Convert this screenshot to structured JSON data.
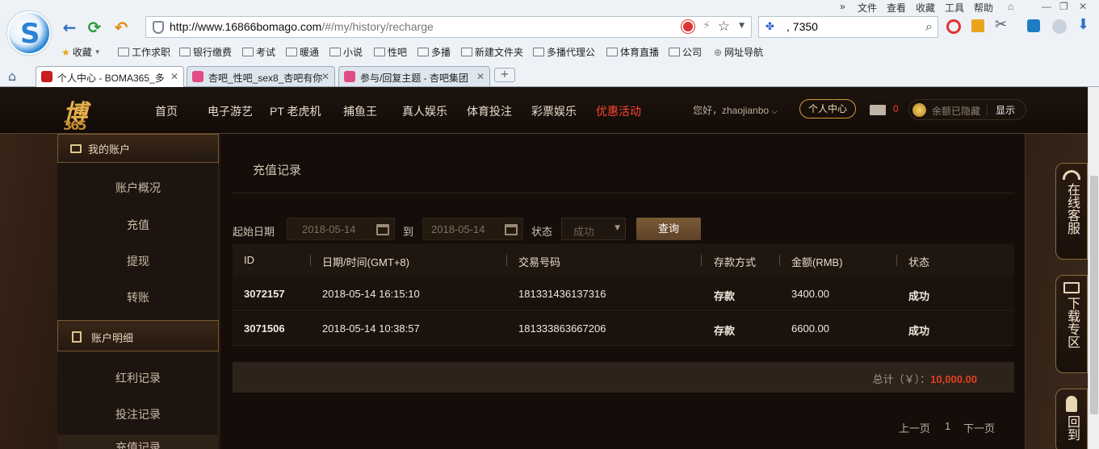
{
  "browser": {
    "url_host": "http://www.16866bomago.com",
    "url_path": "/#/my/history/recharge",
    "search_value": ", 7350",
    "menu": [
      "文件",
      "查看",
      "收藏",
      "工具",
      "帮助"
    ],
    "bookmarks": [
      "收藏",
      "工作求职",
      "银行缴费",
      "考试",
      "暖通",
      "小说",
      "性吧",
      "多播",
      "新建文件夹",
      "多播代理公",
      "体育直播",
      "公司",
      "网址导航"
    ],
    "tabs": [
      "个人中心 - BOMA365_多",
      "杏吧_性吧_sex8_杏吧有你",
      "参与/回复主题 - 杏吧集团"
    ]
  },
  "site": {
    "brand": "博",
    "brand_num": "365",
    "nav": [
      "首页",
      "电子游艺",
      "PT 老虎机",
      "捕鱼王",
      "真人娱乐",
      "体育投注",
      "彩票娱乐",
      "优惠活动"
    ],
    "greeting": "您好，zhaojianbo",
    "center_btn": "个人中心",
    "mail_count": "0",
    "balance_text": "余额已隐藏",
    "balance_show": "显示"
  },
  "sidebar": {
    "head1": "我的账户",
    "items1": [
      "账户概况",
      "充值",
      "提现",
      "转账"
    ],
    "head2": "账户明细",
    "items2": [
      "红利记录",
      "投注记录",
      "充值记录"
    ]
  },
  "main": {
    "title": "充值记录",
    "start_label": "起始日期",
    "start_date": "2018-05-14",
    "to_label": "到",
    "end_date": "2018-05-14",
    "status_label": "状态",
    "status_value": "成功",
    "query_btn": "查询",
    "columns": [
      "ID",
      "日期/时间(GMT+8)",
      "交易号码",
      "存款方式",
      "金额(RMB)",
      "状态"
    ],
    "rows": [
      [
        "3072157",
        "2018-05-14 16:15:10",
        "181331436137316",
        "存款",
        "3400.00",
        "成功"
      ],
      [
        "3071506",
        "2018-05-14 10:38:57",
        "181333863667206",
        "存款",
        "6600.00",
        "成功"
      ]
    ],
    "total_label": "总计（￥）：",
    "total_value": "10,000.00",
    "prev": "上一页",
    "page": "1",
    "next": "下一页"
  },
  "floating": {
    "service": "在线客服",
    "download": "下载专区",
    "top": "回到"
  },
  "colors": {
    "accent": "#d49a39",
    "hot": "#ff4633",
    "total": "#e0411d"
  }
}
